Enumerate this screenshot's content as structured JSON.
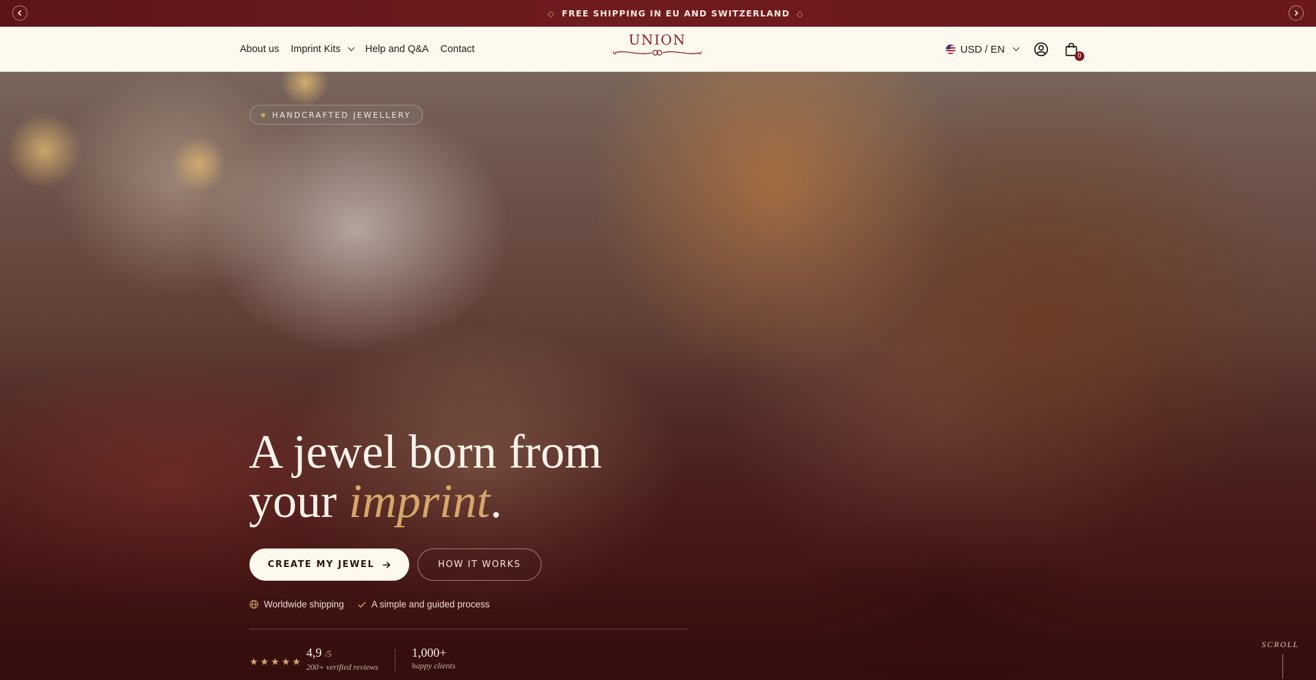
{
  "announcement": {
    "text": "FREE SHIPPING IN EU AND SWITZERLAND",
    "diamond": "◇",
    "prev_icon": "chevron-left-icon",
    "next_icon": "chevron-right-icon"
  },
  "header": {
    "nav": [
      {
        "label": "About us"
      },
      {
        "label": "Imprint Kits",
        "has_dropdown": true
      },
      {
        "label": "Help and Q&A"
      },
      {
        "label": "Contact"
      }
    ],
    "logo_text": "UNION",
    "currency_label": "USD / EN",
    "cart_count": "0",
    "brand_color": "#8a1f24"
  },
  "hero": {
    "badge": "HANDCRAFTED JEWELLERY",
    "headline_line1": "A jewel born from",
    "headline_line2_prefix": "your ",
    "headline_accent": "imprint",
    "headline_suffix": ".",
    "cta_primary": "CREATE MY JEWEL",
    "cta_secondary": "HOW IT WORKS",
    "features": [
      {
        "icon": "globe-icon",
        "label": "Worldwide shipping"
      },
      {
        "icon": "check-icon",
        "label": "A simple and guided process"
      }
    ],
    "rating": {
      "value": "4,9",
      "scale": "/5",
      "stars": 5,
      "caption": "200+ verified reviews"
    },
    "clients": {
      "value": "1,000+",
      "caption": "happy clients"
    },
    "scroll_label": "SCROLL",
    "accent_color": "#d6a76a"
  }
}
